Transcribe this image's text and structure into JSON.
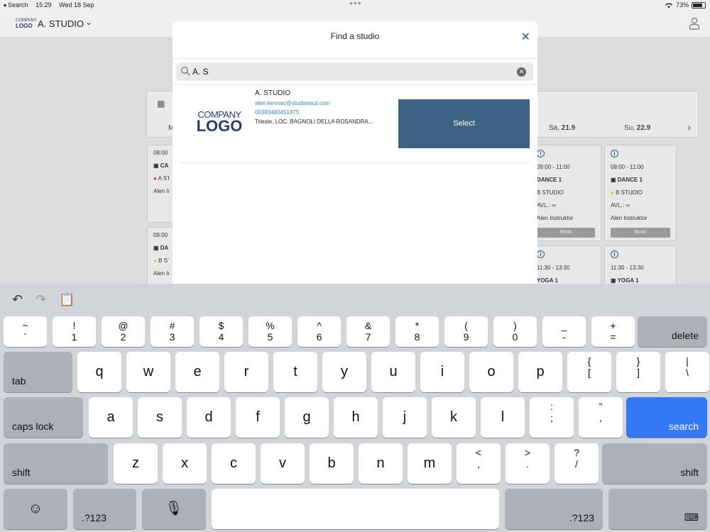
{
  "status_bar": {
    "back_label": "◂ Search",
    "time": "15:29",
    "date": "Wed 18 Sep",
    "battery": "73%"
  },
  "header": {
    "logo_top": "COMPANY",
    "logo_bottom": "LOGO",
    "studio_name": "A. STUDIO"
  },
  "background": {
    "week_start": "M",
    "sat": "Sa, 21.9",
    "sun": "Su, 22.9",
    "cards_left": [
      {
        "time": "08:00",
        "class": "CA",
        "studio": "A ST",
        "instructor": "Alen In"
      },
      {
        "time": "09:00",
        "class": "DA",
        "studio": "B ST",
        "instructor": "Alen In"
      }
    ],
    "cards_right": [
      {
        "time": "09:00 - 11:00",
        "class": "DANCE 1",
        "studio": "B STUDIO",
        "avl": "AVL.: ∞",
        "instructor": "Alen Instruktor",
        "book": "Book"
      },
      {
        "time": "09:00 - 11:00",
        "class": "DANCE 1",
        "studio": "B STUDIO",
        "avl": "AVL.: ∞",
        "instructor": "Alen Instruktor",
        "book": "Book"
      },
      {
        "time": "11:30 - 13:30",
        "class": "YOGA 1"
      },
      {
        "time": "11:30 - 13:30",
        "class": "YOGA 1"
      }
    ]
  },
  "modal": {
    "title": "Find a studio",
    "search_value": "A. S",
    "result": {
      "logo_top": "COMPANY",
      "logo_bottom": "LOGO",
      "name": "A. STUDIO",
      "email": "alen.kermac@studionaut.com",
      "phone": "00393480451875",
      "address": "Trieste, LOC. BAGNOLI DELLA ROSANDRA...",
      "select_label": "Select"
    }
  },
  "keyboard": {
    "row1": [
      [
        "~",
        "`"
      ],
      [
        "!",
        "1"
      ],
      [
        "@",
        "2"
      ],
      [
        "#",
        "3"
      ],
      [
        "$",
        "4"
      ],
      [
        "%",
        "5"
      ],
      [
        "^",
        "6"
      ],
      [
        "&",
        "7"
      ],
      [
        "*",
        "8"
      ],
      [
        "(",
        "9"
      ],
      [
        ")",
        "0"
      ],
      [
        "_",
        "-"
      ],
      [
        "+",
        "="
      ]
    ],
    "delete": "delete",
    "tab": "tab",
    "row2": [
      "q",
      "w",
      "e",
      "r",
      "t",
      "y",
      "u",
      "i",
      "o",
      "p"
    ],
    "row2_sym": [
      [
        "{",
        "["
      ],
      [
        "}",
        "]"
      ],
      [
        "|",
        "\\"
      ]
    ],
    "caps": "caps lock",
    "row3": [
      "a",
      "s",
      "d",
      "f",
      "g",
      "h",
      "j",
      "k",
      "l"
    ],
    "row3_sym": [
      [
        ":",
        ";"
      ],
      [
        "”",
        ","
      ]
    ],
    "search": "search",
    "shift": "shift",
    "row4": [
      "z",
      "x",
      "c",
      "v",
      "b",
      "n",
      "m"
    ],
    "row4_sym": [
      [
        "<",
        ","
      ],
      [
        ">",
        "."
      ],
      [
        "?",
        "/"
      ]
    ],
    "num_label": ".?123",
    "emoji": "☺",
    "mic": "🎙",
    "kb_icon": "⌨"
  }
}
